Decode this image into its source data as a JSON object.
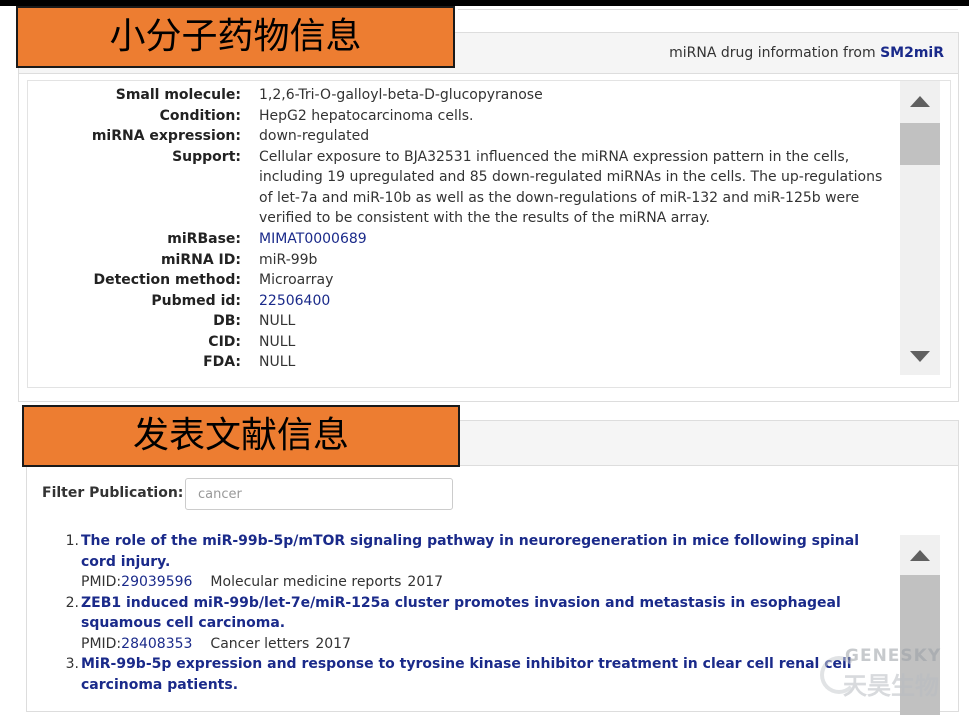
{
  "drug_panel": {
    "overlay_label": "小分子药物信息",
    "source_prefix": "miRNA drug information from",
    "source_name": "SM2miR",
    "fields": [
      {
        "label": "Small molecule:",
        "value": "1,2,6-Tri-O-galloyl-beta-D-glucopyranose",
        "link": false
      },
      {
        "label": "Condition:",
        "value": "HepG2 hepatocarcinoma cells.",
        "link": false
      },
      {
        "label": "miRNA expression:",
        "value": "down-regulated",
        "link": false
      },
      {
        "label": "Support:",
        "value": "Cellular exposure to BJA32531 influenced the miRNA expression pattern in the cells, including 19 upregulated and 85 down-regulated miRNAs in the cells. The up-regulations of let-7a and miR-10b as well as the down-regulations of miR-132 and miR-125b were verified to be consistent with the the results of the miRNA array.",
        "link": false
      },
      {
        "label": "miRBase:",
        "value": "MIMAT0000689",
        "link": true
      },
      {
        "label": "miRNA ID:",
        "value": "miR-99b",
        "link": false
      },
      {
        "label": "Detection method:",
        "value": "Microarray",
        "link": false
      },
      {
        "label": "Pubmed id:",
        "value": "22506400",
        "link": true
      },
      {
        "label": "DB:",
        "value": "NULL",
        "link": false
      },
      {
        "label": "CID:",
        "value": "NULL",
        "link": false
      },
      {
        "label": "FDA:",
        "value": "NULL",
        "link": false
      }
    ]
  },
  "publication_panel": {
    "overlay_label": "发表文献信息",
    "filter_label": "Filter Publication:",
    "filter_placeholder": "cancer",
    "publications": [
      {
        "num": "1.",
        "title": "The role of the miR-99b-5p/mTOR signaling pathway in neuroregeneration in mice following spinal cord injury.",
        "pmid_prefix": "PMID:",
        "pmid": "29039596",
        "journal": "Molecular medicine reports",
        "year": "2017"
      },
      {
        "num": "2.",
        "title": "ZEB1 induced miR-99b/let-7e/miR-125a cluster promotes invasion and metastasis in esophageal squamous cell carcinoma.",
        "pmid_prefix": "PMID:",
        "pmid": "28408353",
        "journal": "Cancer letters",
        "year": "2017"
      },
      {
        "num": "3.",
        "title": "MiR-99b-5p expression and response to tyrosine kinase inhibitor treatment in clear cell renal cell carcinoma patients.",
        "pmid_prefix": "",
        "pmid": "",
        "journal": "",
        "year": ""
      }
    ]
  },
  "watermark": {
    "text_en": "GENESKY",
    "text_cn": "天昊生物"
  },
  "colors": {
    "orange": "#ed7d31",
    "link": "#1a2a8a",
    "panel_heading": "#f5f5f5"
  }
}
